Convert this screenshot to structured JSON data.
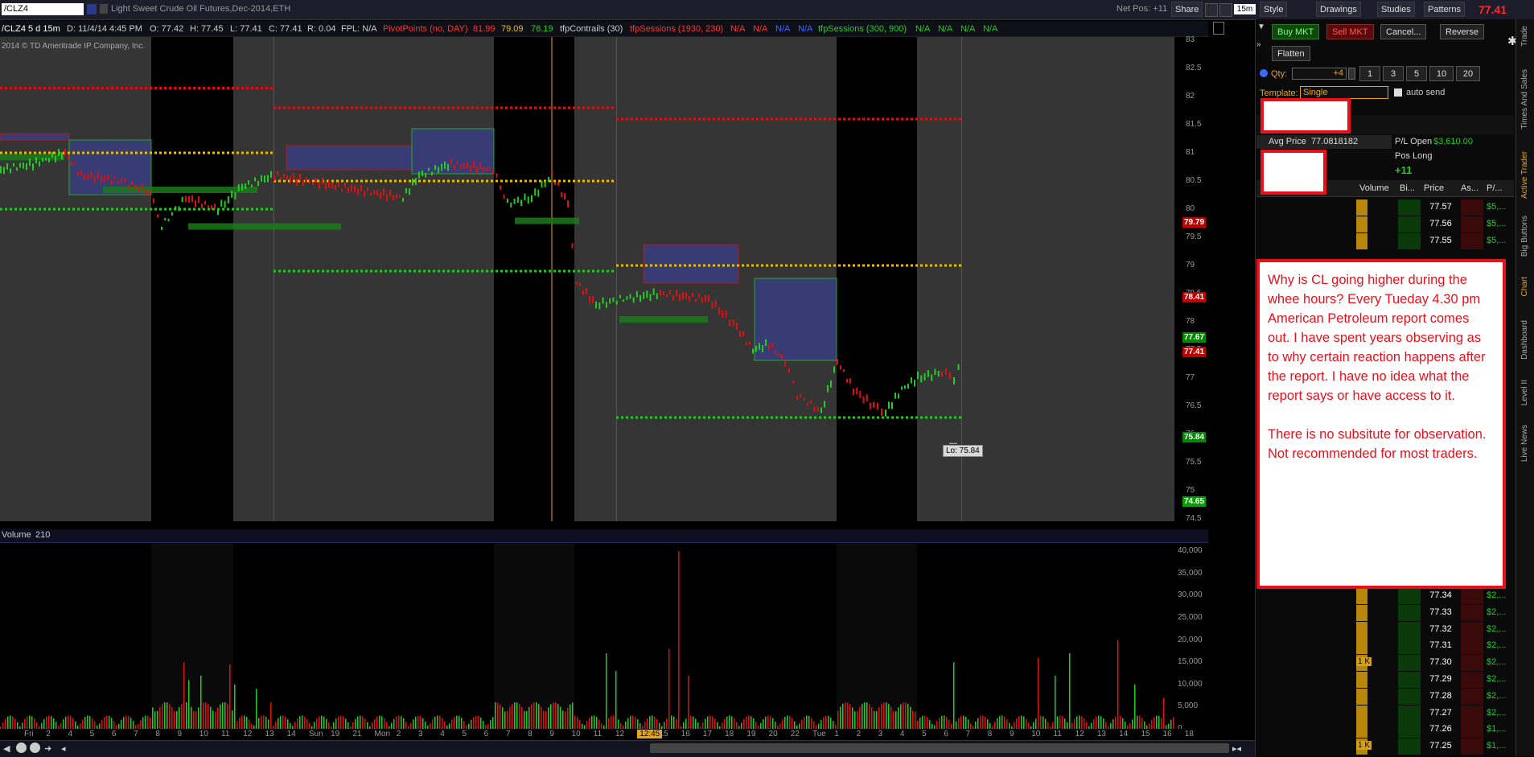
{
  "toolbar": {
    "symbol": "/CLZ4",
    "description": "Light Sweet Crude Oil Futures,Dec-2014,ETH",
    "net_pos": "Net Pos: +11",
    "share": "Share",
    "timeframe": "15m",
    "style": "Style",
    "drawings": "Drawings",
    "studies": "Studies",
    "patterns": "Patterns",
    "last_price": "77.41"
  },
  "infobar": {
    "symbol": "/CLZ4 5 d 15m",
    "date": "D: 11/4/14 4:45 PM",
    "open": "O: 77.42",
    "high": "H: 77.45",
    "low": "L: 77.41",
    "close": "C: 77.41",
    "range": "R: 0.04",
    "fpl": "FPL: N/A",
    "pivot": "PivotPoints (no, DAY)",
    "pivot_v1": "81.99",
    "pivot_v2": "79.09",
    "pivot_v3": "76.19",
    "contrails": "tfpContrails (30)",
    "sessions1": "tfpSessions (1930, 230)",
    "na1": "N/A",
    "na2": "N/A",
    "na3": "N/A",
    "sessions2": "tfpSessions (300, 900)",
    "na4": "N/A",
    "na5": "N/A",
    "na6": "N/A",
    "na7": "N/A"
  },
  "copyright": "2014 © TD Ameritrade IP Company, Inc.",
  "low_label": "Lo: 75.84",
  "price_axis": [
    "83",
    "82.5",
    "82",
    "81.5",
    "81",
    "80.5",
    "80",
    "79.5",
    "79",
    "78.5",
    "78",
    "77.5",
    "77",
    "76.5",
    "76",
    "75.5",
    "75",
    "74.5"
  ],
  "price_badges": {
    "b1": "79.79",
    "b2": "78.41",
    "b3": "77.67",
    "b4": "77.41",
    "b5": "75.84",
    "b6": "74.65"
  },
  "volume": {
    "label": "Volume",
    "value": "210",
    "axis": [
      "40,000",
      "35,000",
      "30,000",
      "25,000",
      "20,000",
      "15,000",
      "10,000",
      "5,000",
      "0"
    ]
  },
  "time_axis": [
    "Fri",
    "2",
    "4",
    "5",
    "6",
    "7",
    "8",
    "9",
    "10",
    "11",
    "12",
    "13",
    "14",
    "Sun",
    "19",
    "21",
    "Mon",
    "2",
    "3",
    "4",
    "5",
    "6",
    "7",
    "8",
    "9",
    "10",
    "11",
    "12",
    "12:45",
    "15",
    "16",
    "17",
    "18",
    "19",
    "20",
    "22",
    "Tue",
    "1",
    "2",
    "3",
    "4",
    "5",
    "6",
    "7",
    "8",
    "9",
    "10",
    "11",
    "12",
    "13",
    "14",
    "15",
    "16",
    "18"
  ],
  "active_trader": {
    "buy": "Buy MKT",
    "sell": "Sell MKT",
    "cancel": "Cancel...",
    "reverse": "Reverse",
    "flatten": "Flatten",
    "qty_label": "Qty:",
    "qty_value": "+4",
    "qty_presets": [
      "1",
      "3",
      "5",
      "10",
      "20"
    ],
    "template_label": "Template:",
    "template_value": "Single",
    "auto_send": "auto send",
    "avg_price_label": "Avg Price",
    "avg_price": "77.0818182",
    "pl_open_label": "P/L Open",
    "pl_open": "$3,610.00",
    "pos_label": "Pos Long",
    "pos_value": "+11",
    "headers": [
      "Volume",
      "Bi...",
      "Price",
      "As...",
      "P/..."
    ],
    "ladder_top": [
      {
        "price": "77.57",
        "pl": "$5,..."
      },
      {
        "price": "77.56",
        "pl": "$5,..."
      },
      {
        "price": "77.55",
        "pl": "$5,..."
      }
    ],
    "ladder_bottom": [
      {
        "vol": "",
        "price": "77.34",
        "pl": "$2,..."
      },
      {
        "vol": "",
        "price": "77.33",
        "pl": "$2,..."
      },
      {
        "vol": "",
        "price": "77.32",
        "pl": "$2,..."
      },
      {
        "vol": "",
        "price": "77.31",
        "pl": "$2,..."
      },
      {
        "vol": "1 K",
        "price": "77.30",
        "pl": "$2,..."
      },
      {
        "vol": "",
        "price": "77.29",
        "pl": "$2,..."
      },
      {
        "vol": "",
        "price": "77.28",
        "pl": "$2,..."
      },
      {
        "vol": "",
        "price": "77.27",
        "pl": "$2,..."
      },
      {
        "vol": "",
        "price": "77.26",
        "pl": "$1,..."
      },
      {
        "vol": "1 K",
        "price": "77.25",
        "pl": "$1,..."
      }
    ]
  },
  "side_tabs": [
    "Trade",
    "Times And Sales",
    "Active Trader",
    "Big Buttons",
    "Chart",
    "Dashboard",
    "Level II",
    "Live News"
  ],
  "annotation": {
    "p1": "Why is CL going higher during the whee hours? Every Tueday 4.30 pm American Petroleum report comes out. I have spent years observing as to why certain reaction happens after  the report. I have no idea what the report says or have access to it.",
    "p2": "There is no subsitute for observation. Not recommended for  most traders."
  },
  "colors": {
    "up": "#22cc22",
    "down": "#e01010",
    "pivot_red": "#e01010",
    "pivot_yellow": "#e8c000",
    "pivot_green": "#22cc22",
    "session_box": "#3a3f8a",
    "accent_orange": "#e8a51a"
  }
}
